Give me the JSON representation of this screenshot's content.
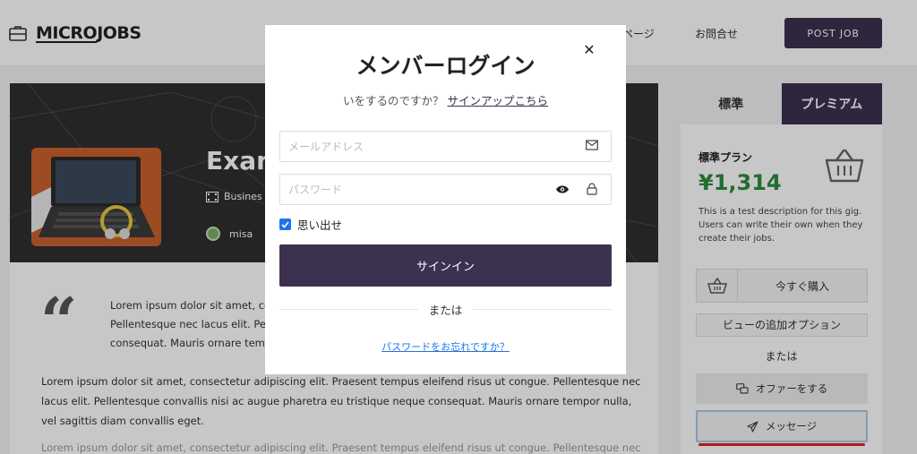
{
  "header": {
    "logo_text_underlined": "MICRO",
    "logo_text_rest": "JOBS",
    "nav_item_1": "ページ",
    "nav_item_2": "お問合せ",
    "post_job_label": "POST JOB"
  },
  "hero": {
    "title": "Exan",
    "category": "Busines",
    "user": "misa"
  },
  "content": {
    "quote_lines": [
      "Lorem ipsum dolor sit amet, co",
      "Pellentesque nec lacus elit. Pell",
      "consequat. Mauris ornare temp"
    ],
    "paragraph_lines": [
      "Lorem ipsum dolor sit amet, consectetur adipiscing elit. Praesent tempus eleifend risus ut congue. Pellentesque nec",
      "lacus elit. Pellentesque convallis nisi ac augue pharetra eu tristique neque consequat. Mauris ornare tempor nulla,",
      "vel sagittis diam convallis eget."
    ],
    "paragraph2_line": "Lorem ipsum dolor sit amet, consectetur adipiscing elit. Praesent tempus eleifend risus ut congue. Pellentesque nec"
  },
  "sidebar": {
    "tab_standard": "標準",
    "tab_premium": "プレミアム",
    "plan_name": "標準プラン",
    "plan_price": "¥1,314",
    "plan_description": "This is a test description for this gig. Users can write their own when they create their jobs.",
    "buy_now_label": "今すぐ購入",
    "extra_options_label": "ビューの追加オプション",
    "or_label": "または",
    "make_offer_label": "オファーをする",
    "message_label": "メッセージ"
  },
  "modal": {
    "title": "メンバーログイン",
    "subtitle_text": "いをするのですか？",
    "signup_link": "サインアップこちら",
    "email_placeholder": "メールアドレス",
    "password_placeholder": "パスワード",
    "remember_label": "思い出せ",
    "remember_checked": true,
    "signin_label": "サインイン",
    "or_label": "または",
    "forgot_label": "パスワードをお忘れですか？"
  },
  "colors": {
    "brand": "#3d3150",
    "price_green": "#2e8b3e",
    "link_blue": "#1e73e8",
    "highlight_red": "#e02020"
  }
}
